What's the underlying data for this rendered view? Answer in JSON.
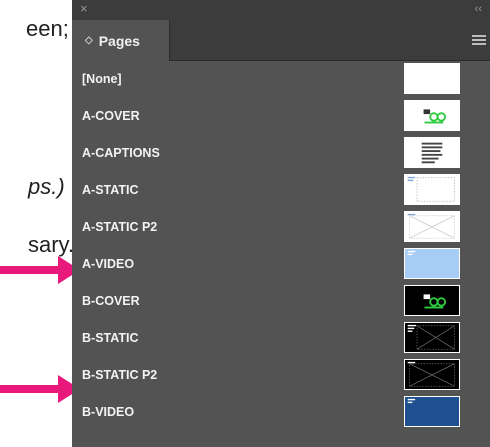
{
  "background": {
    "line1": "een;",
    "line2": "ps.)",
    "line3": "sary."
  },
  "panel": {
    "collapse_label": "‹‹",
    "tab_label": "Pages",
    "tab_icon": "chevron-icon",
    "menu_icon": "hamburger-menu-icon",
    "items": [
      {
        "label": "[None]",
        "thumb": "white-blank"
      },
      {
        "label": "A-COVER",
        "thumb": "white-logo"
      },
      {
        "label": "A-CAPTIONS",
        "thumb": "white-text"
      },
      {
        "label": "A-STATIC",
        "thumb": "white-dotted"
      },
      {
        "label": "A-STATIC P2",
        "thumb": "white-x"
      },
      {
        "label": "A-VIDEO",
        "thumb": "light-blue"
      },
      {
        "label": "B-COVER",
        "thumb": "black-logo"
      },
      {
        "label": "B-STATIC",
        "thumb": "black-x"
      },
      {
        "label": "B-STATIC P2",
        "thumb": "black-x"
      },
      {
        "label": "B-VIDEO",
        "thumb": "navy"
      }
    ]
  },
  "colors": {
    "panel_bg": "#535353",
    "titlebar_bg": "#3c3c3c",
    "arrow": "#e8197b",
    "light_blue": "#a8cdf5",
    "navy": "#1e4f8f",
    "logo_green": "#2ecc40"
  }
}
